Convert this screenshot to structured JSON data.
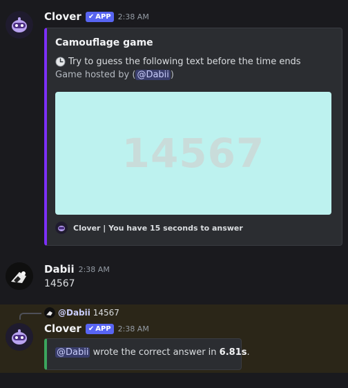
{
  "message1": {
    "author": "Clover",
    "badge": "APP",
    "time": "2:38 AM",
    "embed": {
      "title": "Camouflage game",
      "description": "Try to guess the following text before the time ends",
      "hosted_prefix": "Game hosted by (",
      "hosted_mention": "@Dabii",
      "hosted_suffix": ")",
      "captcha_text": "14567",
      "footer": "Clover | You have 15 seconds to answer"
    }
  },
  "message2": {
    "author": "Dabii",
    "time": "2:38 AM",
    "content": "14567"
  },
  "message3": {
    "reply_author": "@Dabii",
    "reply_content": "14567",
    "author": "Clover",
    "badge": "APP",
    "time": "2:38 AM",
    "embed": {
      "mention": "@Dabii",
      "text": "wrote the correct answer in",
      "value": "6.81s",
      "suffix": "."
    }
  },
  "colors": {
    "accent_purple": "#7b2ff7",
    "accent_green": "#3ba55d",
    "app_badge": "#5865f2",
    "captcha_bg": "#bdf2ef",
    "highlight_bg": "#2b2618"
  }
}
